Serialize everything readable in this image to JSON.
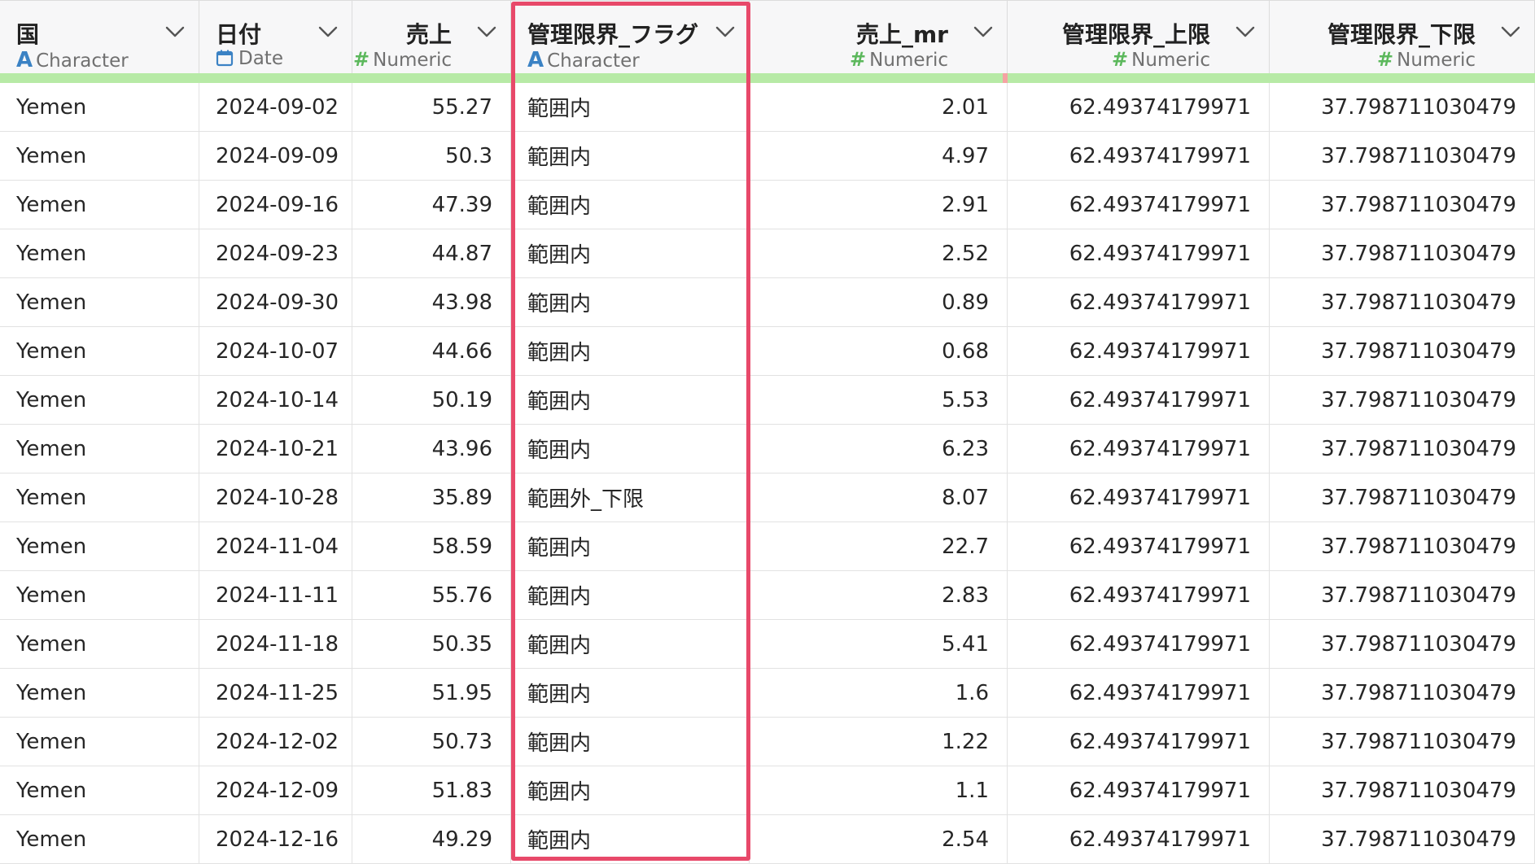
{
  "columns": [
    {
      "name": "国",
      "type": "Character",
      "icon": "character-type-icon",
      "align": "left",
      "width": 245
    },
    {
      "name": "日付",
      "type": "Date",
      "icon": "calendar-icon",
      "align": "left",
      "width": 188
    },
    {
      "name": "売上",
      "type": "Numeric",
      "icon": "numeric-type-icon",
      "align": "right",
      "width": 195
    },
    {
      "name": "管理限界_フラグ",
      "type": "Character",
      "icon": "character-type-icon",
      "align": "left",
      "width": 293
    },
    {
      "name": "売上_mr",
      "type": "Numeric",
      "icon": "numeric-type-icon",
      "align": "right",
      "width": 317
    },
    {
      "name": "管理限界_上限",
      "type": "Numeric",
      "icon": "numeric-type-icon",
      "align": "right",
      "width": 322
    },
    {
      "name": "管理限界_下限",
      "type": "Numeric",
      "icon": "numeric-type-icon",
      "align": "right",
      "width": 326
    }
  ],
  "rows": [
    [
      "Yemen",
      "2024-09-02",
      "55.27",
      "範囲内",
      "2.01",
      "62.49374179971",
      "37.798711030479"
    ],
    [
      "Yemen",
      "2024-09-09",
      "50.3",
      "範囲内",
      "4.97",
      "62.49374179971",
      "37.798711030479"
    ],
    [
      "Yemen",
      "2024-09-16",
      "47.39",
      "範囲内",
      "2.91",
      "62.49374179971",
      "37.798711030479"
    ],
    [
      "Yemen",
      "2024-09-23",
      "44.87",
      "範囲内",
      "2.52",
      "62.49374179971",
      "37.798711030479"
    ],
    [
      "Yemen",
      "2024-09-30",
      "43.98",
      "範囲内",
      "0.89",
      "62.49374179971",
      "37.798711030479"
    ],
    [
      "Yemen",
      "2024-10-07",
      "44.66",
      "範囲内",
      "0.68",
      "62.49374179971",
      "37.798711030479"
    ],
    [
      "Yemen",
      "2024-10-14",
      "50.19",
      "範囲内",
      "5.53",
      "62.49374179971",
      "37.798711030479"
    ],
    [
      "Yemen",
      "2024-10-21",
      "43.96",
      "範囲内",
      "6.23",
      "62.49374179971",
      "37.798711030479"
    ],
    [
      "Yemen",
      "2024-10-28",
      "35.89",
      "範囲外_下限",
      "8.07",
      "62.49374179971",
      "37.798711030479"
    ],
    [
      "Yemen",
      "2024-11-04",
      "58.59",
      "範囲内",
      "22.7",
      "62.49374179971",
      "37.798711030479"
    ],
    [
      "Yemen",
      "2024-11-11",
      "55.76",
      "範囲内",
      "2.83",
      "62.49374179971",
      "37.798711030479"
    ],
    [
      "Yemen",
      "2024-11-18",
      "50.35",
      "範囲内",
      "5.41",
      "62.49374179971",
      "37.798711030479"
    ],
    [
      "Yemen",
      "2024-11-25",
      "51.95",
      "範囲内",
      "1.6",
      "62.49374179971",
      "37.798711030479"
    ],
    [
      "Yemen",
      "2024-12-02",
      "50.73",
      "範囲内",
      "1.22",
      "62.49374179971",
      "37.798711030479"
    ],
    [
      "Yemen",
      "2024-12-09",
      "51.83",
      "範囲内",
      "1.1",
      "62.49374179971",
      "37.798711030479"
    ],
    [
      "Yemen",
      "2024-12-16",
      "49.29",
      "範囲内",
      "2.54",
      "62.49374179971",
      "37.798711030479"
    ]
  ],
  "colors": {
    "highlight_border": "#e8496a",
    "header_bar": "#b7eaa6",
    "char_icon": "#3b82c4",
    "num_icon": "#5cb85c",
    "date_icon": "#3b82c4"
  }
}
